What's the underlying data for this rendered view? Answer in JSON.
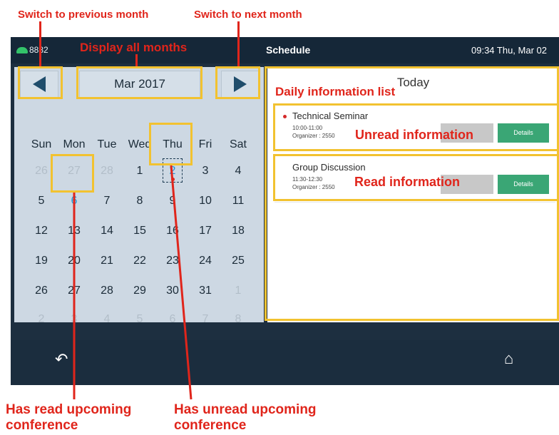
{
  "annotations": {
    "prev_month": "Switch to previous month",
    "next_month": "Switch to next month",
    "display_all": "Display all months",
    "daily_list": "Daily information list",
    "unread_info": "Unread information",
    "read_info": "Read information",
    "has_read_line1": "Has read upcoming",
    "has_read_line2": "conference",
    "has_unread_line1": "Has unread upcoming",
    "has_unread_line2": "conference"
  },
  "status_bar": {
    "extension": "8882",
    "title": "Schedule",
    "time": "09:34 Thu, Mar 02"
  },
  "calendar": {
    "month_label": "Mar 2017",
    "weekdays": [
      "Sun",
      "Mon",
      "Tue",
      "Wed",
      "Thu",
      "Fri",
      "Sat"
    ],
    "weeks": [
      [
        {
          "d": "26",
          "dim": true
        },
        {
          "d": "27",
          "dim": true
        },
        {
          "d": "28",
          "dim": true
        },
        {
          "d": "1"
        },
        {
          "d": "2",
          "unread": true
        },
        {
          "d": "3"
        },
        {
          "d": "4"
        }
      ],
      [
        {
          "d": "5"
        },
        {
          "d": "6",
          "read": true
        },
        {
          "d": "7"
        },
        {
          "d": "8"
        },
        {
          "d": "9"
        },
        {
          "d": "10"
        },
        {
          "d": "11"
        }
      ],
      [
        {
          "d": "12"
        },
        {
          "d": "13"
        },
        {
          "d": "14"
        },
        {
          "d": "15"
        },
        {
          "d": "16"
        },
        {
          "d": "17"
        },
        {
          "d": "18"
        }
      ],
      [
        {
          "d": "19"
        },
        {
          "d": "20"
        },
        {
          "d": "21"
        },
        {
          "d": "22"
        },
        {
          "d": "23"
        },
        {
          "d": "24"
        },
        {
          "d": "25"
        }
      ],
      [
        {
          "d": "26"
        },
        {
          "d": "27"
        },
        {
          "d": "28"
        },
        {
          "d": "29"
        },
        {
          "d": "30"
        },
        {
          "d": "31"
        },
        {
          "d": "1",
          "dim": true
        }
      ],
      [
        {
          "d": "2",
          "dim": true
        },
        {
          "d": "3",
          "dim": true
        },
        {
          "d": "4",
          "dim": true
        },
        {
          "d": "5",
          "dim": true
        },
        {
          "d": "6",
          "dim": true
        },
        {
          "d": "7",
          "dim": true
        },
        {
          "d": "8",
          "dim": true
        }
      ]
    ]
  },
  "panel": {
    "title": "Today",
    "events": [
      {
        "title": "Technical Seminar",
        "time": "10:00-11:00",
        "organizer": "Organizer : 2550",
        "unread": true,
        "details_label": "Details"
      },
      {
        "title": "Group Discussion",
        "time": "11:30-12:30",
        "organizer": "Organizer : 2550",
        "unread": false,
        "details_label": "Details"
      }
    ]
  },
  "icons": {
    "back": "back-arrow-icon",
    "home": "home-icon",
    "phone": "phone-icon"
  },
  "colors": {
    "annotation_red": "#e0251b",
    "highlight_yellow": "#f2c230",
    "status_bar": "#152738",
    "calendar_bg": "#cdd8e3",
    "details_green": "#3aa675",
    "read_blue": "#1e9be0"
  }
}
